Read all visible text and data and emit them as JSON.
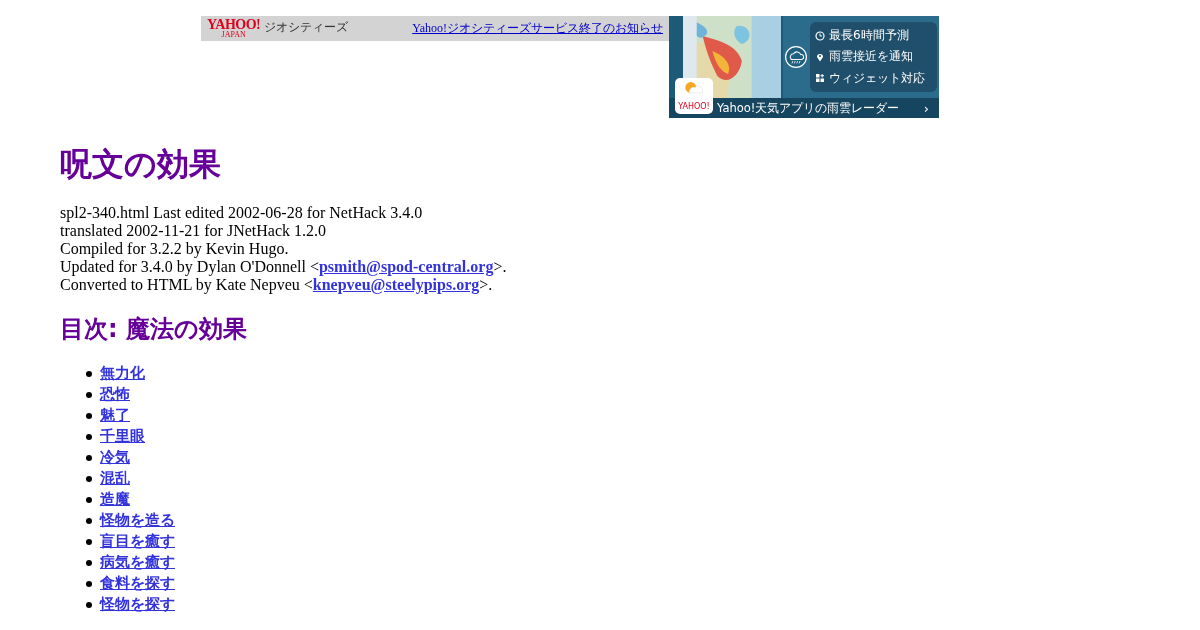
{
  "topbar": {
    "logo": "YAHOO!",
    "logo_sub": "JAPAN",
    "service": "ジオシティーズ",
    "notice_link": "Yahoo!ジオシティーズサービス終了のお知らせ"
  },
  "ad": {
    "features": [
      {
        "kind": "clock",
        "text": "最長6時間予測"
      },
      {
        "kind": "pin",
        "text": "雨雲接近を通知"
      },
      {
        "kind": "widget",
        "text": "ウィジェット対応"
      }
    ],
    "app_badge": "YAHOO!",
    "caption": "Yahoo!天気アプリの雨雲レーダー",
    "chevron": "›"
  },
  "title": "呪文の効果",
  "credits": [
    {
      "text": "spl2-340.html Last edited 2002-06-28 for NetHack 3.4.0"
    },
    {
      "text": "translated 2002-11-21 for JNetHack 1.2.0"
    },
    {
      "text": "Compiled for 3.2.2 by Kevin Hugo."
    },
    {
      "text": "Updated for 3.4.0 by Dylan O'Donnell <",
      "link": "psmith@spod-central.org",
      "after": ">."
    },
    {
      "text": "Converted to HTML by Kate Nepveu <",
      "link": "knepveu@steelypips.org",
      "after": ">."
    }
  ],
  "toc": {
    "heading": "目次: 魔法の効果",
    "items": [
      "無力化",
      "恐怖",
      "魅了",
      "千里眼",
      "冷気",
      "混乱",
      "造魔",
      "怪物を造る",
      "盲目を癒す",
      "病気を癒す",
      "食料を探す",
      "怪物を探す"
    ]
  }
}
